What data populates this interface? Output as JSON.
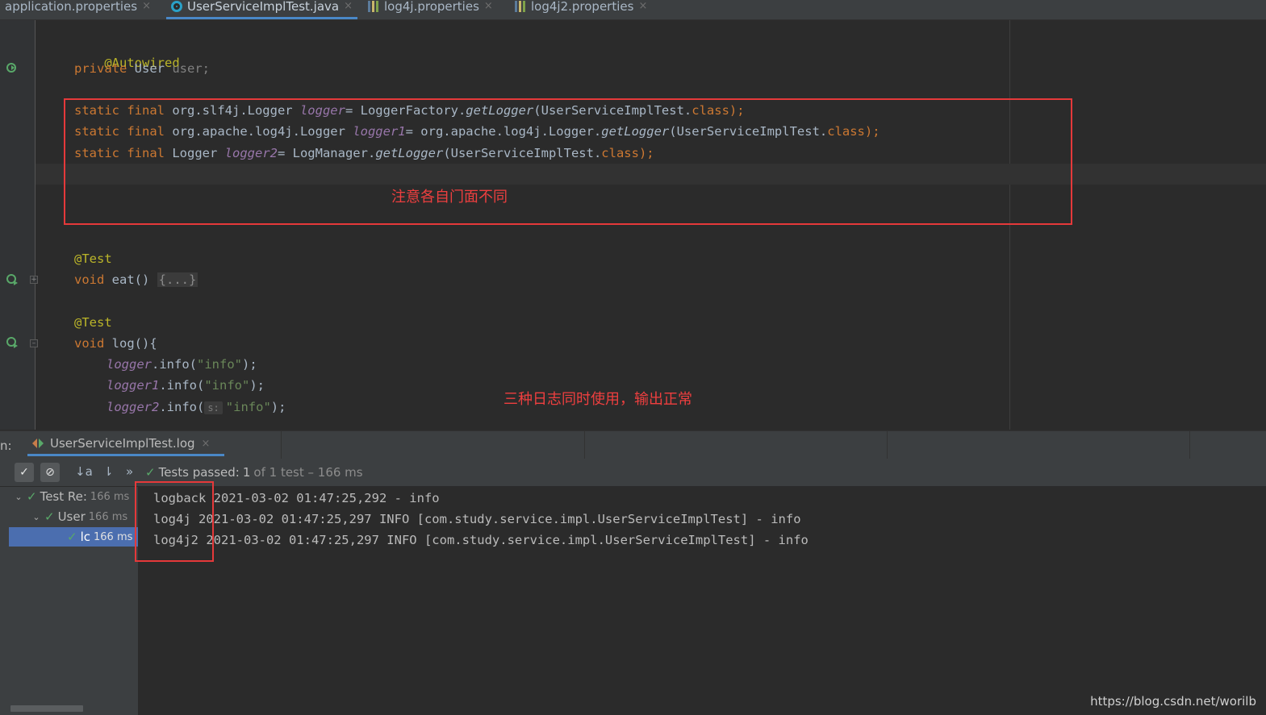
{
  "tabs": [
    {
      "label": "application.properties",
      "icon": "properties-file-icon"
    },
    {
      "label": "UserServiceImplTest.java",
      "icon": "java-class-icon",
      "active": true
    },
    {
      "label": "log4j.properties",
      "icon": "properties-file-icon"
    },
    {
      "label": "log4j2.properties",
      "icon": "properties-file-icon"
    }
  ],
  "close_glyph": "×",
  "code": {
    "autowired": "@Autowired",
    "user_decl": {
      "kw": "private ",
      "type": "User ",
      "name": "user",
      "semi": ";"
    },
    "logger_slf4j": {
      "kw": "static final ",
      "type": "org.slf4j.Logger ",
      "field": "logger",
      "eq": "= LoggerFactory.",
      "method": "getLogger",
      "open": "(UserServiceImplTest.",
      "cls": "class",
      "close": ");"
    },
    "logger_log4j": {
      "kw": "static final ",
      "type": "org.apache.log4j.Logger ",
      "field": "logger1",
      "eq": "= org.apache.log4j.Logger.",
      "method": "getLogger",
      "open": "(UserServiceImplTest.",
      "cls": "class",
      "close": ");"
    },
    "logger_log4j2": {
      "kw": "static final ",
      "type": "Logger ",
      "field": "logger2",
      "eq": "= LogManager.",
      "method": "getLogger",
      "open": "(UserServiceImplTest.",
      "cls": "class",
      "close": ");"
    },
    "test1_ann": "@Test",
    "eat_decl": {
      "kw": "void ",
      "name": "eat",
      "parens": "() ",
      "folded": "{...}"
    },
    "test2_ann": "@Test",
    "log_decl": {
      "kw": "void ",
      "name": "log",
      "rest": "(){"
    },
    "call1": {
      "field": "logger",
      "call": ".info(",
      "str": "\"info\"",
      "end": ");"
    },
    "call2": {
      "field": "logger1",
      "call": ".info(",
      "str": "\"info\"",
      "end": ");"
    },
    "call3": {
      "field": "logger2",
      "call": ".info(",
      "hint": "s:",
      "str": "\"info\"",
      "end": ");"
    }
  },
  "annotations": {
    "facades_note": "注意各自门面不同",
    "output_note": "三种日志同时使用，输出正常"
  },
  "run_panel": {
    "label": "n:",
    "tab_label": "UserServiceImplTest.log",
    "toolbar": {
      "sort_alpha": "↓a",
      "sort_duration": "⇂",
      "more": "»"
    },
    "status": {
      "passed": "Tests passed:",
      "count": "1",
      "detail": "of 1 test – 166 ms"
    },
    "tree": [
      {
        "label": "Test Re:",
        "time": "166 ms",
        "depth": 0,
        "selected": false
      },
      {
        "label": "User",
        "time": "166 ms",
        "depth": 1,
        "selected": false
      },
      {
        "label": "lc",
        "time": "166 ms",
        "depth": 2,
        "selected": true
      }
    ],
    "console_lines": [
      "logback 2021-03-02 01:47:25,292 - info",
      "log4j 2021-03-02 01:47:25,297 INFO [com.study.service.impl.UserServiceImplTest] - info",
      "log4j2 2021-03-02 01:47:25,297 INFO [com.study.service.impl.UserServiceImplTest] - info"
    ]
  },
  "watermark": "https://blog.csdn.net/worilb",
  "colors": {
    "keyword": "#cc7832",
    "annotation": "#bbb529",
    "field": "#9876aa",
    "string": "#6a8759",
    "highlight_box": "#e5393a",
    "selection": "#4b6eaf",
    "pass": "#59a869"
  }
}
